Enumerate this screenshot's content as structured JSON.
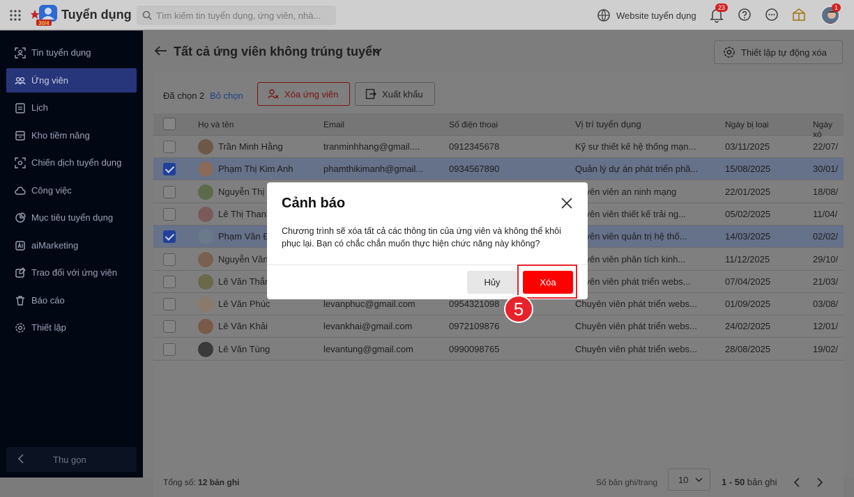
{
  "topbar": {
    "brand": "Tuyển dụng",
    "logo_text": "30/4",
    "search_placeholder": "Tìm kiếm tin tuyển dụng, ứng viên, nhà...",
    "website_label": "Website tuyển dụng",
    "notification_count": "23",
    "avatar_badge": "1"
  },
  "sidebar": {
    "items": [
      {
        "label": "Tin tuyển dụng",
        "icon": "scan-user-icon"
      },
      {
        "label": "Ứng viên",
        "icon": "users-icon"
      },
      {
        "label": "Lịch",
        "icon": "calendar-icon"
      },
      {
        "label": "Kho tiềm năng",
        "icon": "archive-icon"
      },
      {
        "label": "Chiến dịch tuyển dụng",
        "icon": "campaign-icon"
      },
      {
        "label": "Công việc",
        "icon": "cloud-task-icon"
      },
      {
        "label": "Mục tiêu tuyển dụng",
        "icon": "target-chart-icon"
      },
      {
        "label": "aiMarketing",
        "icon": "ai-icon"
      },
      {
        "label": "Trao đổi với ứng viên",
        "icon": "chat-edit-icon"
      },
      {
        "label": "Báo cáo",
        "icon": "trash-report-icon"
      },
      {
        "label": "Thiết lập",
        "icon": "gear-icon"
      }
    ],
    "collapse_label": "Thu gọn"
  },
  "page": {
    "title": "Tất cả ứng viên không trúng tuyển",
    "auto_delete_label": "Thiết lập tự động xóa"
  },
  "toolbar": {
    "selected_text": "Đã chọn 2",
    "unselect_label": "Bỏ chọn",
    "delete_label": "Xóa ứng viên",
    "export_label": "Xuất khẩu"
  },
  "table": {
    "headers": [
      "Họ và tên",
      "Email",
      "Số điện thoại",
      "Vị trí tuyển dụng",
      "Ngày bị loại",
      "Ngày xó"
    ],
    "rows": [
      {
        "name": "Trần Minh Hằng",
        "email": "tranminhhang@gmail....",
        "phone": "0912345678",
        "position": "Kỹ sư thiết kế hệ thống mạn...",
        "rejected": "03/11/2025",
        "deleted": "22/07/",
        "checked": false
      },
      {
        "name": "Phạm Thị Kim Anh",
        "email": "phamthikimanh@gmail...",
        "phone": "0934567890",
        "position": "Quản lý dự án phát triển phầ...",
        "rejected": "15/08/2025",
        "deleted": "30/01/",
        "checked": true
      },
      {
        "name": "Nguyễn Thị",
        "email": "",
        "phone": "",
        "position": "huyên viên an ninh mạng",
        "rejected": "22/01/2025",
        "deleted": "18/08/",
        "checked": false
      },
      {
        "name": "Lê Thị Thanh",
        "email": "",
        "phone": "",
        "position": "huyên viên thiết kế trải ng...",
        "rejected": "05/02/2025",
        "deleted": "11/04/",
        "checked": false
      },
      {
        "name": "Phạm Văn Đ",
        "email": "",
        "phone": "",
        "position": "huyên viên quản trị hệ thố...",
        "rejected": "14/03/2025",
        "deleted": "02/02/",
        "checked": true
      },
      {
        "name": "Nguyễn Văn",
        "email": "",
        "phone": "",
        "position": "huyên viên phân tích kinh...",
        "rejected": "11/12/2025",
        "deleted": "29/10/",
        "checked": false
      },
      {
        "name": "Lê Văn Thắn",
        "email": "",
        "phone": "",
        "position": "huyên viên phát triển webs...",
        "rejected": "07/04/2025",
        "deleted": "21/03/",
        "checked": false
      },
      {
        "name": "Lê Văn Phúc",
        "email": "levanphuc@gmail.com",
        "phone": "0954321098",
        "position": "Chuyên viên phát triển webs...",
        "rejected": "01/09/2025",
        "deleted": "03/08/",
        "checked": false
      },
      {
        "name": "Lê Văn Khải",
        "email": "levankhai@gmail.com",
        "phone": "0972109876",
        "position": "Chuyên viên phát triển webs...",
        "rejected": "24/02/2025",
        "deleted": "12/01/",
        "checked": false
      },
      {
        "name": "Lê Văn Tùng",
        "email": "levantung@gmail.com",
        "phone": "0990098765",
        "position": "Chuyên viên phát triển webs...",
        "rejected": "28/08/2025",
        "deleted": "19/02/",
        "checked": false
      }
    ]
  },
  "footer": {
    "total_prefix": "Tổng số:",
    "total_value": "12 bản ghi",
    "per_page_label": "Số bản ghi/trang",
    "per_page_value": "10",
    "range_value": "1 - 50",
    "range_suffix": "bản ghi"
  },
  "modal": {
    "title": "Cảnh báo",
    "message": "Chương trình sẽ xóa tất cả các thông tin của ứng viên và không thể khôi phục lại. Bạn có chắc chắn muốn thực hiện chức năng này không?",
    "cancel_label": "Hủy",
    "confirm_label": "Xóa"
  },
  "annotation": {
    "step_number": "5",
    "highlight_color": "#e8222a"
  },
  "colors": {
    "primary": "#20409a",
    "danger": "#ff0000",
    "sidebar_bg": "#020714"
  }
}
